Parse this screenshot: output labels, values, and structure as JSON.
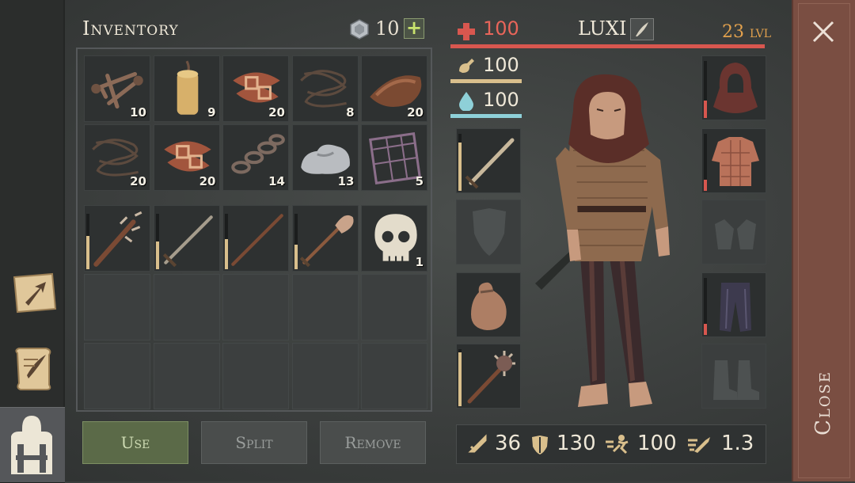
{
  "inventory": {
    "title": "Inventory",
    "currency": "10",
    "add_label": "+",
    "items": [
      {
        "name": "nails-icon",
        "count": "10"
      },
      {
        "name": "candle-icon",
        "count": "9"
      },
      {
        "name": "leather-straps-icon",
        "count": "20"
      },
      {
        "name": "rope-icon",
        "count": "8"
      },
      {
        "name": "leather-roll-icon",
        "count": "20"
      },
      {
        "name": "rope-icon",
        "count": "20"
      },
      {
        "name": "leather-straps-icon",
        "count": "20"
      },
      {
        "name": "chain-icon",
        "count": "14"
      },
      {
        "name": "stone-icon",
        "count": "13"
      },
      {
        "name": "lattice-icon",
        "count": "5"
      },
      {
        "name": "spiked-club-icon",
        "count": "",
        "durability": 0.6
      },
      {
        "name": "sword-icon",
        "count": "",
        "durability": 0.5
      },
      {
        "name": "staff-icon",
        "count": "",
        "durability": 0.55
      },
      {
        "name": "shovel-icon",
        "count": "",
        "durability": 0.45
      },
      {
        "name": "skull-icon",
        "count": "1"
      }
    ]
  },
  "buttons": {
    "use": "Use",
    "split": "Split",
    "remove": "Remove"
  },
  "character": {
    "name": "LUXI",
    "level": "23",
    "level_unit": "LVL",
    "health": "100",
    "hunger": "100",
    "thirst": "100"
  },
  "equipment": {
    "left": [
      {
        "name": "equipped-sword-icon",
        "durability": 0.85
      },
      {
        "name": "empty-shield-slot-icon"
      },
      {
        "name": "equipped-bag-icon"
      },
      {
        "name": "equipped-mace-icon",
        "durability": 0.95
      }
    ],
    "right": [
      {
        "name": "equipped-hood-icon",
        "durability": 0.3
      },
      {
        "name": "equipped-tunic-icon",
        "durability": 0.2
      },
      {
        "name": "empty-gloves-slot-icon"
      },
      {
        "name": "equipped-pants-icon",
        "durability": 0.2
      },
      {
        "name": "empty-boots-slot-icon"
      }
    ]
  },
  "stats": {
    "attack": "36",
    "defense": "130",
    "speed": "100",
    "attack_speed": "1.3"
  },
  "close_label": "Close",
  "colors": {
    "health": "#d8574f",
    "hunger": "#d9bf8c",
    "thirst": "#8ed0d8",
    "level": "#e2a14d",
    "use_button": "#5b6a48",
    "close_panel": "#7a4e42"
  }
}
